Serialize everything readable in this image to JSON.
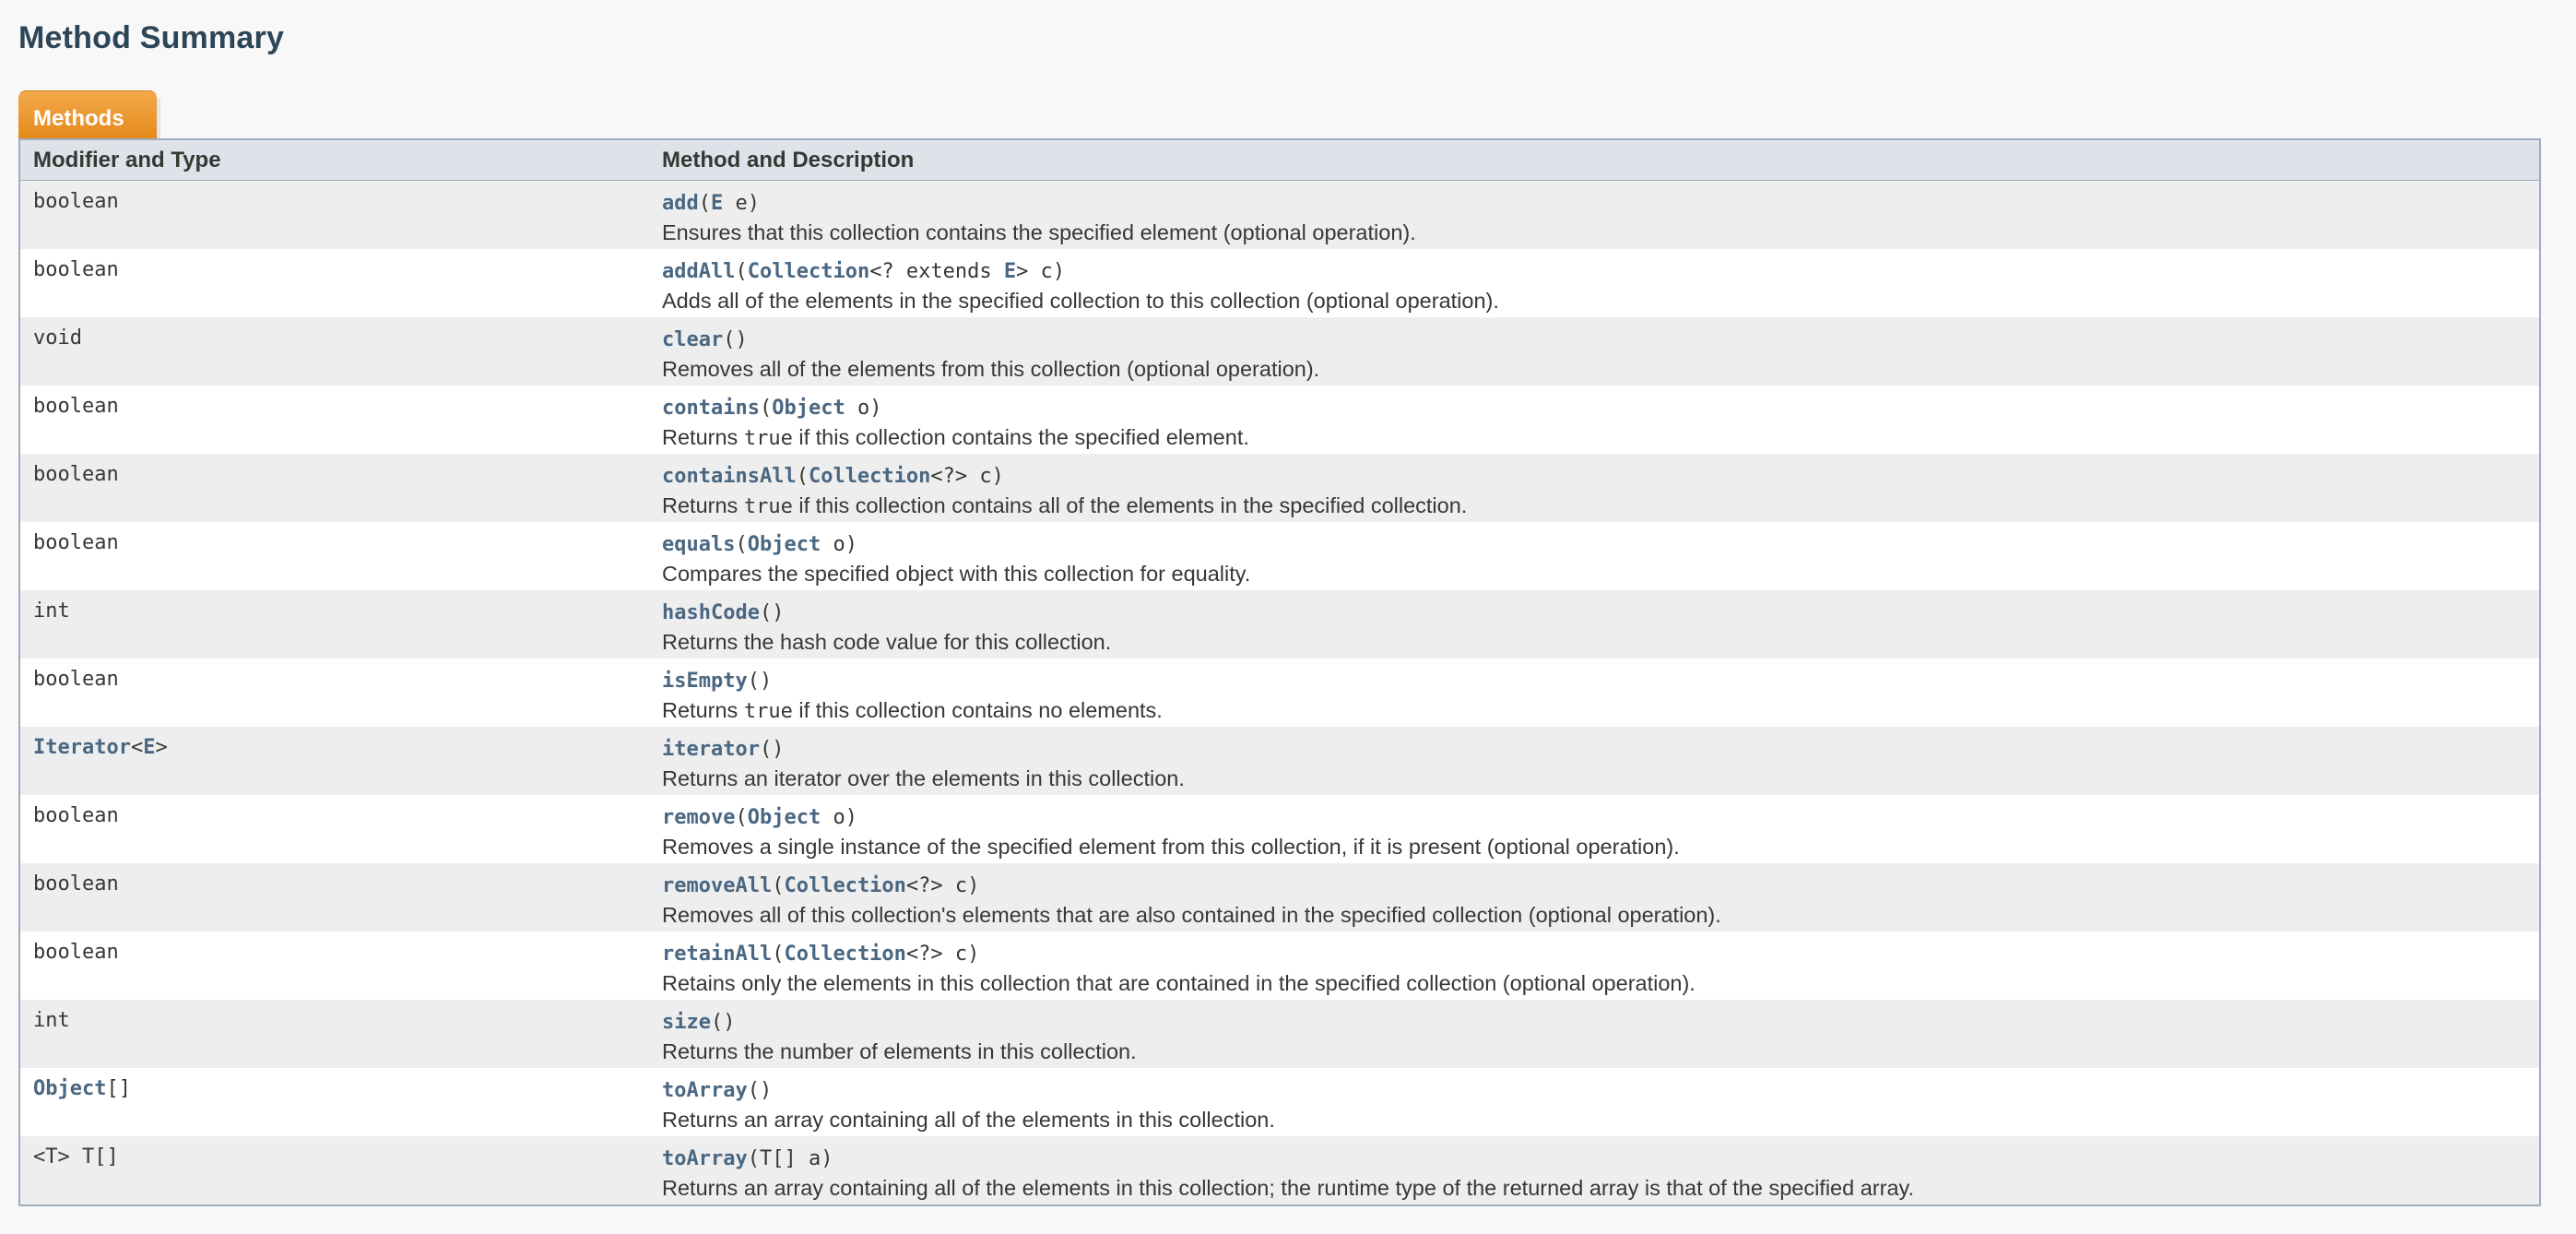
{
  "section": {
    "title": "Method Summary",
    "tab_label": "Methods"
  },
  "table": {
    "headers": {
      "type": "Modifier and Type",
      "method": "Method and Description"
    },
    "rows": [
      {
        "type_link": "",
        "type_text": "boolean",
        "method": "add",
        "params": [
          {
            "t": "(",
            "l": false
          },
          {
            "t": "E",
            "l": true
          },
          {
            "t": " e)",
            "l": false
          }
        ],
        "desc": [
          {
            "t": "Ensures that this collection contains the specified element (optional operation).",
            "c": false
          }
        ]
      },
      {
        "type_link": "",
        "type_text": "boolean",
        "method": "addAll",
        "params": [
          {
            "t": "(",
            "l": false
          },
          {
            "t": "Collection",
            "l": true
          },
          {
            "t": "<? extends ",
            "l": false
          },
          {
            "t": "E",
            "l": true
          },
          {
            "t": "> c)",
            "l": false
          }
        ],
        "desc": [
          {
            "t": "Adds all of the elements in the specified collection to this collection (optional operation).",
            "c": false
          }
        ]
      },
      {
        "type_link": "",
        "type_text": "void",
        "method": "clear",
        "params": [
          {
            "t": "()",
            "l": false
          }
        ],
        "desc": [
          {
            "t": "Removes all of the elements from this collection (optional operation).",
            "c": false
          }
        ]
      },
      {
        "type_link": "",
        "type_text": "boolean",
        "method": "contains",
        "params": [
          {
            "t": "(",
            "l": false
          },
          {
            "t": "Object",
            "l": true
          },
          {
            "t": " o)",
            "l": false
          }
        ],
        "desc": [
          {
            "t": "Returns ",
            "c": false
          },
          {
            "t": "true",
            "c": true
          },
          {
            "t": " if this collection contains the specified element.",
            "c": false
          }
        ]
      },
      {
        "type_link": "",
        "type_text": "boolean",
        "method": "containsAll",
        "params": [
          {
            "t": "(",
            "l": false
          },
          {
            "t": "Collection",
            "l": true
          },
          {
            "t": "<?> c)",
            "l": false
          }
        ],
        "desc": [
          {
            "t": "Returns ",
            "c": false
          },
          {
            "t": "true",
            "c": true
          },
          {
            "t": " if this collection contains all of the elements in the specified collection.",
            "c": false
          }
        ]
      },
      {
        "type_link": "",
        "type_text": "boolean",
        "method": "equals",
        "params": [
          {
            "t": "(",
            "l": false
          },
          {
            "t": "Object",
            "l": true
          },
          {
            "t": " o)",
            "l": false
          }
        ],
        "desc": [
          {
            "t": "Compares the specified object with this collection for equality.",
            "c": false
          }
        ]
      },
      {
        "type_link": "",
        "type_text": "int",
        "method": "hashCode",
        "params": [
          {
            "t": "()",
            "l": false
          }
        ],
        "desc": [
          {
            "t": "Returns the hash code value for this collection.",
            "c": false
          }
        ]
      },
      {
        "type_link": "",
        "type_text": "boolean",
        "method": "isEmpty",
        "params": [
          {
            "t": "()",
            "l": false
          }
        ],
        "desc": [
          {
            "t": "Returns ",
            "c": false
          },
          {
            "t": "true",
            "c": true
          },
          {
            "t": " if this collection contains no elements.",
            "c": false
          }
        ]
      },
      {
        "type_link": "Iterator",
        "type_text": "<E>",
        "method": "iterator",
        "params": [
          {
            "t": "()",
            "l": false
          }
        ],
        "desc": [
          {
            "t": "Returns an iterator over the elements in this collection.",
            "c": false
          }
        ],
        "type_extra_link": "E"
      },
      {
        "type_link": "",
        "type_text": "boolean",
        "method": "remove",
        "params": [
          {
            "t": "(",
            "l": false
          },
          {
            "t": "Object",
            "l": true
          },
          {
            "t": " o)",
            "l": false
          }
        ],
        "desc": [
          {
            "t": "Removes a single instance of the specified element from this collection, if it is present (optional operation).",
            "c": false
          }
        ]
      },
      {
        "type_link": "",
        "type_text": "boolean",
        "method": "removeAll",
        "params": [
          {
            "t": "(",
            "l": false
          },
          {
            "t": "Collection",
            "l": true
          },
          {
            "t": "<?> c)",
            "l": false
          }
        ],
        "desc": [
          {
            "t": "Removes all of this collection's elements that are also contained in the specified collection (optional operation).",
            "c": false
          }
        ]
      },
      {
        "type_link": "",
        "type_text": "boolean",
        "method": "retainAll",
        "params": [
          {
            "t": "(",
            "l": false
          },
          {
            "t": "Collection",
            "l": true
          },
          {
            "t": "<?> c)",
            "l": false
          }
        ],
        "desc": [
          {
            "t": "Retains only the elements in this collection that are contained in the specified collection (optional operation).",
            "c": false
          }
        ]
      },
      {
        "type_link": "",
        "type_text": "int",
        "method": "size",
        "params": [
          {
            "t": "()",
            "l": false
          }
        ],
        "desc": [
          {
            "t": "Returns the number of elements in this collection.",
            "c": false
          }
        ]
      },
      {
        "type_link": "Object",
        "type_text": "[]",
        "method": "toArray",
        "params": [
          {
            "t": "()",
            "l": false
          }
        ],
        "desc": [
          {
            "t": "Returns an array containing all of the elements in this collection.",
            "c": false
          }
        ]
      },
      {
        "type_link": "",
        "type_text": "<T> T[]",
        "method": "toArray",
        "params": [
          {
            "t": "(T[] a)",
            "l": false
          }
        ],
        "desc": [
          {
            "t": "Returns an array containing all of the elements in this collection; the runtime type of the returned array is that of the specified array.",
            "c": false
          }
        ]
      }
    ]
  },
  "colors": {
    "link": "#4a6782",
    "tab": "#e48a1c",
    "header_bg": "#dee3e9",
    "row_alt": "#eeeeef"
  }
}
